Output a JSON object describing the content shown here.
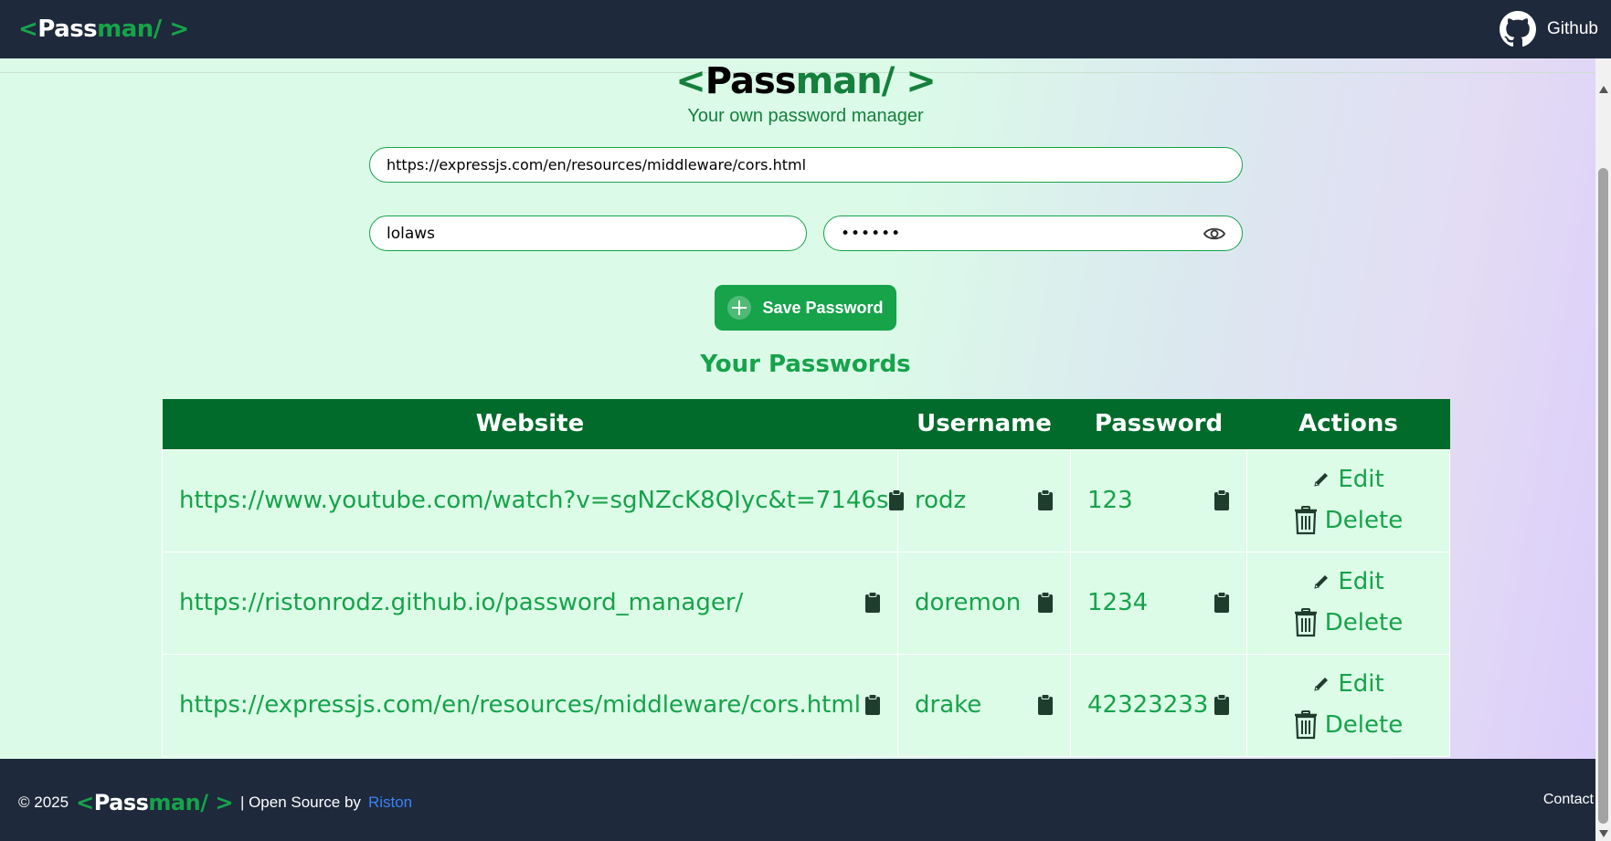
{
  "navbar": {
    "logo": {
      "open": "<",
      "pass": "Pass",
      "man": "man/",
      "close": " >"
    },
    "github_label": "Github"
  },
  "hero": {
    "logo": {
      "open": "<",
      "pass": "Pass",
      "man": "man/",
      "close": " >"
    },
    "tagline": "Your own password manager"
  },
  "form": {
    "url_value": "https://expressjs.com/en/resources/middleware/cors.html",
    "username_value": "lolaws",
    "password_masked": "••••••",
    "save_label": "Save Password"
  },
  "passwords_title": "Your Passwords",
  "table": {
    "headers": [
      "Website",
      "Username",
      "Password",
      "Actions"
    ],
    "rows": [
      {
        "website": "https://www.youtube.com/watch?v=sgNZcK8QIyc&t=7146s",
        "username": "rodz",
        "password": "123"
      },
      {
        "website": "https://ristonrodz.github.io/password_manager/",
        "username": "doremon",
        "password": "1234"
      },
      {
        "website": "https://expressjs.com/en/resources/middleware/cors.html",
        "username": "drake",
        "password": "42323233"
      }
    ],
    "edit_label": "Edit",
    "delete_label": "Delete"
  },
  "footer": {
    "copyright": "© 2025",
    "logo": {
      "open": "<",
      "pass": "Pass",
      "man": "man/",
      "close": " >"
    },
    "credit": "| Open Source by",
    "author": "Riston",
    "contact": "Contact"
  },
  "colors": {
    "navbar_bg": "#1e293b",
    "accent_green": "#16a34a",
    "table_header": "#006b2a",
    "table_row": "#dcfce7",
    "link_blue": "#3b82f6"
  }
}
